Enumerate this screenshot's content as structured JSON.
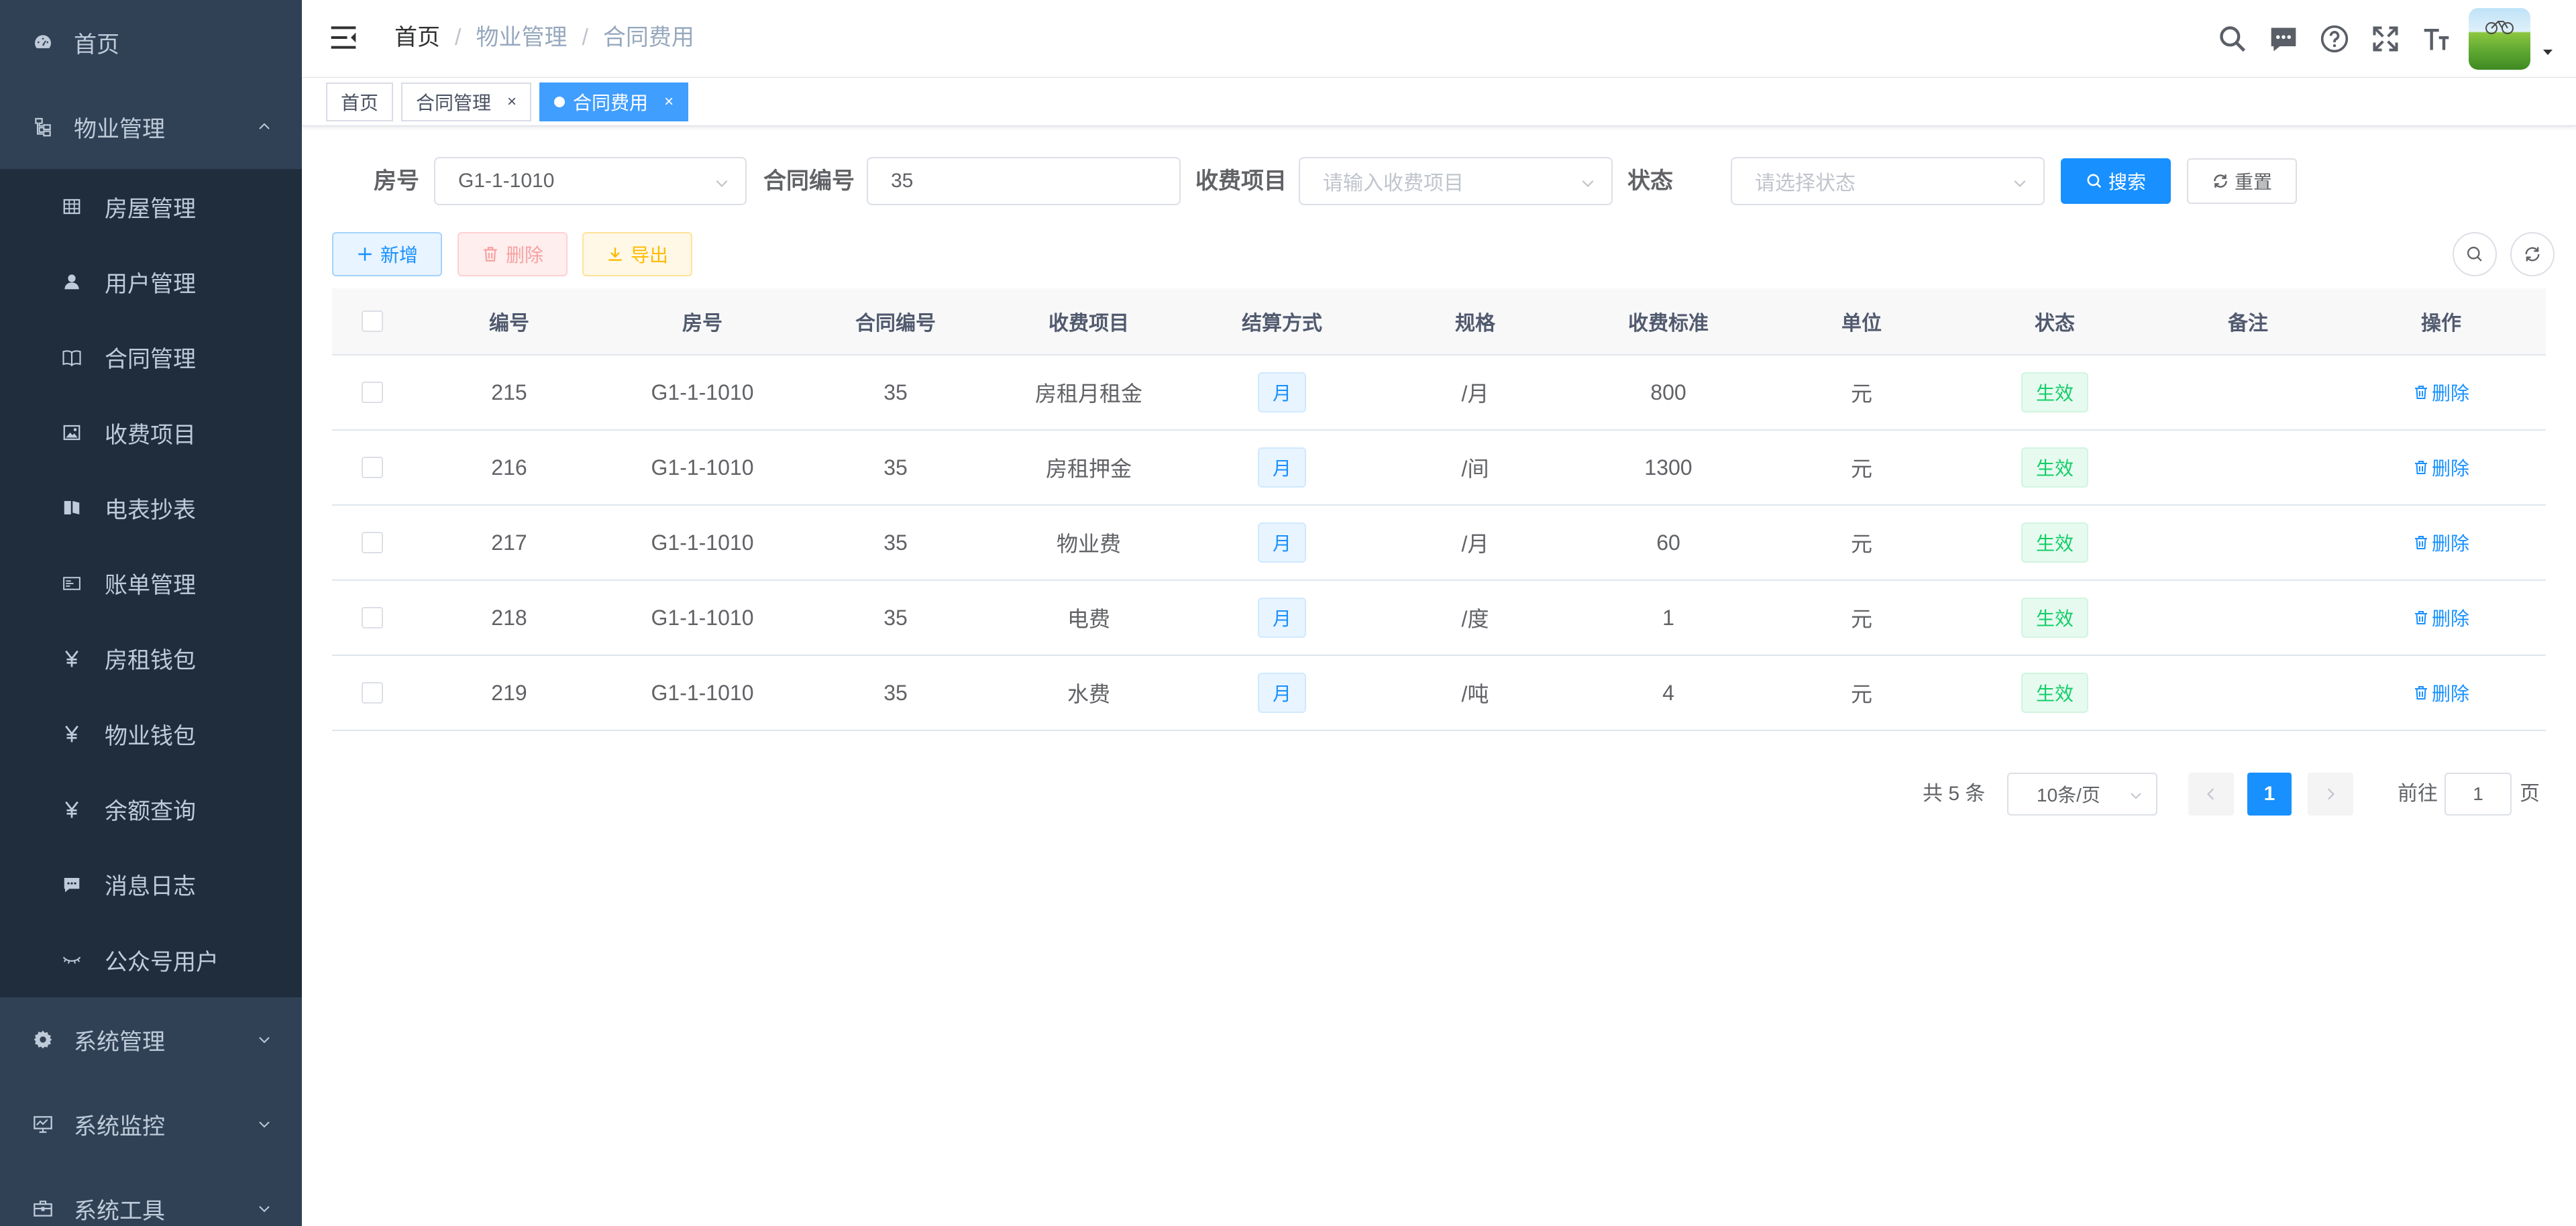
{
  "sidebar": {
    "home": "首页",
    "property": {
      "label": "物业管理",
      "items": [
        {
          "label": "房屋管理",
          "icon": "table-icon"
        },
        {
          "label": "用户管理",
          "icon": "user-icon"
        },
        {
          "label": "合同管理",
          "icon": "book-icon"
        },
        {
          "label": "收费项目",
          "icon": "image-icon"
        },
        {
          "label": "电表抄表",
          "icon": "documentation-icon"
        },
        {
          "label": "账单管理",
          "icon": "form-icon"
        },
        {
          "label": "房租钱包",
          "icon": "yen-icon"
        },
        {
          "label": "物业钱包",
          "icon": "yen-icon"
        },
        {
          "label": "余额查询",
          "icon": "yen-icon"
        },
        {
          "label": "消息日志",
          "icon": "message-icon"
        },
        {
          "label": "公众号用户",
          "icon": "eye-icon"
        }
      ]
    },
    "system_manage": "系统管理",
    "system_monitor": "系统监控",
    "system_tools": "系统工具"
  },
  "navbar": {
    "breadcrumb": [
      "首页",
      "物业管理",
      "合同费用"
    ],
    "icons": [
      "search-icon",
      "message-icon",
      "question-icon",
      "fullscreen-icon",
      "size-icon"
    ]
  },
  "tags": [
    {
      "label": "首页",
      "active": false,
      "closable": false
    },
    {
      "label": "合同管理",
      "active": false,
      "closable": true
    },
    {
      "label": "合同费用",
      "active": true,
      "closable": true
    }
  ],
  "tag_close": "×",
  "search": {
    "room_label": "房号",
    "room_value": "G1-1-1010",
    "contract_label": "合同编号",
    "contract_value": "35",
    "item_label": "收费项目",
    "item_placeholder": "请输入收费项目",
    "status_label": "状态",
    "status_placeholder": "请选择状态",
    "search_btn": "搜索",
    "reset_btn": "重置"
  },
  "toolbar": {
    "add": "新增",
    "delete": "删除",
    "export": "导出"
  },
  "table": {
    "columns": [
      "编号",
      "房号",
      "合同编号",
      "收费项目",
      "结算方式",
      "规格",
      "收费标准",
      "单位",
      "状态",
      "备注",
      "操作"
    ],
    "rows": [
      {
        "id": "215",
        "room": "G1-1-1010",
        "contract": "35",
        "item": "房租月租金",
        "settle": "月",
        "spec": "/月",
        "standard": "800",
        "unit": "元",
        "status": "生效",
        "remark": "",
        "action": "删除"
      },
      {
        "id": "216",
        "room": "G1-1-1010",
        "contract": "35",
        "item": "房租押金",
        "settle": "月",
        "spec": "/间",
        "standard": "1300",
        "unit": "元",
        "status": "生效",
        "remark": "",
        "action": "删除"
      },
      {
        "id": "217",
        "room": "G1-1-1010",
        "contract": "35",
        "item": "物业费",
        "settle": "月",
        "spec": "/月",
        "standard": "60",
        "unit": "元",
        "status": "生效",
        "remark": "",
        "action": "删除"
      },
      {
        "id": "218",
        "room": "G1-1-1010",
        "contract": "35",
        "item": "电费",
        "settle": "月",
        "spec": "/度",
        "standard": "1",
        "unit": "元",
        "status": "生效",
        "remark": "",
        "action": "删除"
      },
      {
        "id": "219",
        "room": "G1-1-1010",
        "contract": "35",
        "item": "水费",
        "settle": "月",
        "spec": "/吨",
        "standard": "4",
        "unit": "元",
        "status": "生效",
        "remark": "",
        "action": "删除"
      }
    ]
  },
  "pagination": {
    "total": "共 5 条",
    "page_size": "10条/页",
    "current": "1",
    "goto_label": "前往",
    "goto_value": "1",
    "page_label": "页"
  },
  "colors": {
    "sidebar_bg": "#304156",
    "submenu_bg": "#1f2d3d",
    "primary": "#1890ff",
    "success": "#13ce66",
    "danger": "#ff4949",
    "warning": "#ffba00"
  }
}
